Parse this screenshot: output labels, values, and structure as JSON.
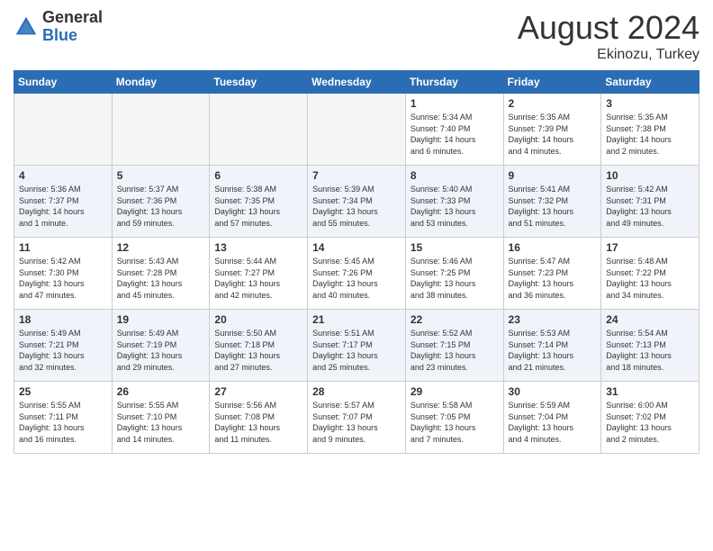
{
  "header": {
    "logo_general": "General",
    "logo_blue": "Blue",
    "month_year": "August 2024",
    "location": "Ekinozu, Turkey"
  },
  "weekdays": [
    "Sunday",
    "Monday",
    "Tuesday",
    "Wednesday",
    "Thursday",
    "Friday",
    "Saturday"
  ],
  "weeks": [
    [
      {
        "day": "",
        "info": ""
      },
      {
        "day": "",
        "info": ""
      },
      {
        "day": "",
        "info": ""
      },
      {
        "day": "",
        "info": ""
      },
      {
        "day": "1",
        "info": "Sunrise: 5:34 AM\nSunset: 7:40 PM\nDaylight: 14 hours\nand 6 minutes."
      },
      {
        "day": "2",
        "info": "Sunrise: 5:35 AM\nSunset: 7:39 PM\nDaylight: 14 hours\nand 4 minutes."
      },
      {
        "day": "3",
        "info": "Sunrise: 5:35 AM\nSunset: 7:38 PM\nDaylight: 14 hours\nand 2 minutes."
      }
    ],
    [
      {
        "day": "4",
        "info": "Sunrise: 5:36 AM\nSunset: 7:37 PM\nDaylight: 14 hours\nand 1 minute."
      },
      {
        "day": "5",
        "info": "Sunrise: 5:37 AM\nSunset: 7:36 PM\nDaylight: 13 hours\nand 59 minutes."
      },
      {
        "day": "6",
        "info": "Sunrise: 5:38 AM\nSunset: 7:35 PM\nDaylight: 13 hours\nand 57 minutes."
      },
      {
        "day": "7",
        "info": "Sunrise: 5:39 AM\nSunset: 7:34 PM\nDaylight: 13 hours\nand 55 minutes."
      },
      {
        "day": "8",
        "info": "Sunrise: 5:40 AM\nSunset: 7:33 PM\nDaylight: 13 hours\nand 53 minutes."
      },
      {
        "day": "9",
        "info": "Sunrise: 5:41 AM\nSunset: 7:32 PM\nDaylight: 13 hours\nand 51 minutes."
      },
      {
        "day": "10",
        "info": "Sunrise: 5:42 AM\nSunset: 7:31 PM\nDaylight: 13 hours\nand 49 minutes."
      }
    ],
    [
      {
        "day": "11",
        "info": "Sunrise: 5:42 AM\nSunset: 7:30 PM\nDaylight: 13 hours\nand 47 minutes."
      },
      {
        "day": "12",
        "info": "Sunrise: 5:43 AM\nSunset: 7:28 PM\nDaylight: 13 hours\nand 45 minutes."
      },
      {
        "day": "13",
        "info": "Sunrise: 5:44 AM\nSunset: 7:27 PM\nDaylight: 13 hours\nand 42 minutes."
      },
      {
        "day": "14",
        "info": "Sunrise: 5:45 AM\nSunset: 7:26 PM\nDaylight: 13 hours\nand 40 minutes."
      },
      {
        "day": "15",
        "info": "Sunrise: 5:46 AM\nSunset: 7:25 PM\nDaylight: 13 hours\nand 38 minutes."
      },
      {
        "day": "16",
        "info": "Sunrise: 5:47 AM\nSunset: 7:23 PM\nDaylight: 13 hours\nand 36 minutes."
      },
      {
        "day": "17",
        "info": "Sunrise: 5:48 AM\nSunset: 7:22 PM\nDaylight: 13 hours\nand 34 minutes."
      }
    ],
    [
      {
        "day": "18",
        "info": "Sunrise: 5:49 AM\nSunset: 7:21 PM\nDaylight: 13 hours\nand 32 minutes."
      },
      {
        "day": "19",
        "info": "Sunrise: 5:49 AM\nSunset: 7:19 PM\nDaylight: 13 hours\nand 29 minutes."
      },
      {
        "day": "20",
        "info": "Sunrise: 5:50 AM\nSunset: 7:18 PM\nDaylight: 13 hours\nand 27 minutes."
      },
      {
        "day": "21",
        "info": "Sunrise: 5:51 AM\nSunset: 7:17 PM\nDaylight: 13 hours\nand 25 minutes."
      },
      {
        "day": "22",
        "info": "Sunrise: 5:52 AM\nSunset: 7:15 PM\nDaylight: 13 hours\nand 23 minutes."
      },
      {
        "day": "23",
        "info": "Sunrise: 5:53 AM\nSunset: 7:14 PM\nDaylight: 13 hours\nand 21 minutes."
      },
      {
        "day": "24",
        "info": "Sunrise: 5:54 AM\nSunset: 7:13 PM\nDaylight: 13 hours\nand 18 minutes."
      }
    ],
    [
      {
        "day": "25",
        "info": "Sunrise: 5:55 AM\nSunset: 7:11 PM\nDaylight: 13 hours\nand 16 minutes."
      },
      {
        "day": "26",
        "info": "Sunrise: 5:55 AM\nSunset: 7:10 PM\nDaylight: 13 hours\nand 14 minutes."
      },
      {
        "day": "27",
        "info": "Sunrise: 5:56 AM\nSunset: 7:08 PM\nDaylight: 13 hours\nand 11 minutes."
      },
      {
        "day": "28",
        "info": "Sunrise: 5:57 AM\nSunset: 7:07 PM\nDaylight: 13 hours\nand 9 minutes."
      },
      {
        "day": "29",
        "info": "Sunrise: 5:58 AM\nSunset: 7:05 PM\nDaylight: 13 hours\nand 7 minutes."
      },
      {
        "day": "30",
        "info": "Sunrise: 5:59 AM\nSunset: 7:04 PM\nDaylight: 13 hours\nand 4 minutes."
      },
      {
        "day": "31",
        "info": "Sunrise: 6:00 AM\nSunset: 7:02 PM\nDaylight: 13 hours\nand 2 minutes."
      }
    ]
  ]
}
